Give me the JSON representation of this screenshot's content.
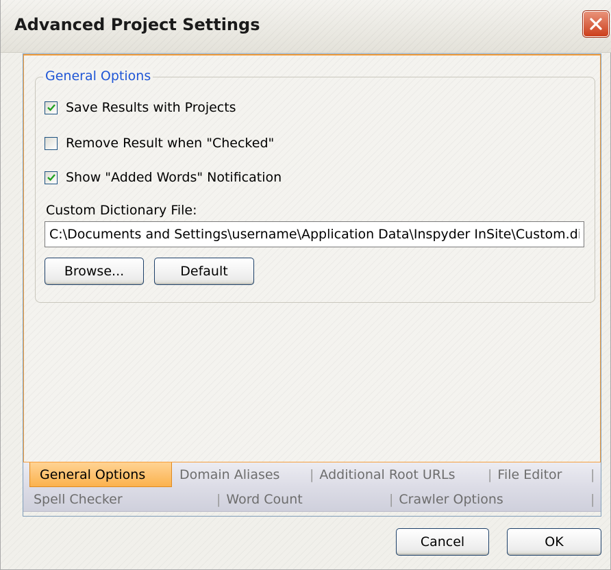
{
  "window": {
    "title": "Advanced Project Settings"
  },
  "group": {
    "legend": "General Options",
    "checkboxes": [
      {
        "label": "Save Results with Projects",
        "checked": true
      },
      {
        "label": "Remove Result when \"Checked\"",
        "checked": false
      },
      {
        "label": "Show \"Added Words\" Notification",
        "checked": true
      }
    ],
    "dict_label": "Custom Dictionary File:",
    "dict_value": "C:\\Documents and Settings\\username\\Application Data\\Inspyder InSite\\Custom.di",
    "browse_label": "Browse...",
    "default_label": "Default"
  },
  "tabs": {
    "row1": [
      "General Options",
      "Domain Aliases",
      "Additional Root URLs",
      "File Editor"
    ],
    "row2": [
      "Spell Checker",
      "Word Count",
      "Crawler Options"
    ],
    "active": "General Options"
  },
  "footer": {
    "cancel_label": "Cancel",
    "ok_label": "OK"
  },
  "colors": {
    "accent_orange": "#f59e3c",
    "legend_blue": "#1f56d6",
    "check_green": "#21a121",
    "close_red": "#cc3f1c"
  }
}
